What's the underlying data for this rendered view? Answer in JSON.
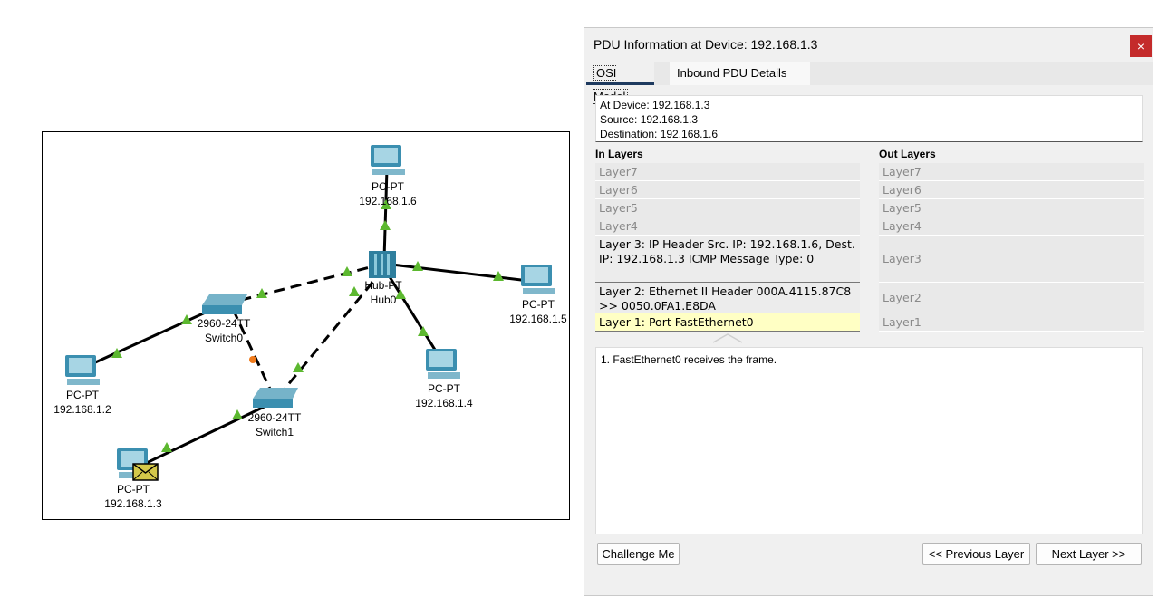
{
  "topology": {
    "devices": [
      {
        "id": "pc6",
        "type": "PC-PT",
        "ip": "192.168.1.6"
      },
      {
        "id": "hub0",
        "type": "Hub-PT",
        "name": "Hub0"
      },
      {
        "id": "pc5",
        "type": "PC-PT",
        "ip": "192.168.1.5"
      },
      {
        "id": "switch0",
        "type": "2960-24TT",
        "name": "Switch0"
      },
      {
        "id": "pc4",
        "type": "PC-PT",
        "ip": "192.168.1.4"
      },
      {
        "id": "pc2",
        "type": "PC-PT",
        "ip": "192.168.1.2"
      },
      {
        "id": "switch1",
        "type": "2960-24TT",
        "name": "Switch1"
      },
      {
        "id": "pc3",
        "type": "PC-PT",
        "ip": "192.168.1.3"
      }
    ],
    "colors": {
      "link": "#000000",
      "link_up": "#5cb82f",
      "link_pending": "#f07a1a",
      "device": "#3b8fb0",
      "envelope": "#d4c84a"
    }
  },
  "dialog": {
    "title": "PDU Information at Device: 192.168.1.3",
    "close_icon": "×",
    "tabs": [
      {
        "label": "OSI Model",
        "selected": true
      },
      {
        "label": "Inbound PDU Details",
        "selected": false
      }
    ],
    "info": {
      "at_device": "At Device: 192.168.1.3",
      "source": "Source: 192.168.1.3",
      "destination": "Destination: 192.168.1.6"
    },
    "in_layers_title": "In Layers",
    "out_layers_title": "Out Layers",
    "in_layers": [
      "Layer7",
      "Layer6",
      "Layer5",
      "Layer4",
      "Layer 3: IP Header Src. IP: 192.168.1.6, Dest. IP: 192.168.1.3 ICMP Message Type: 0",
      "Layer 2: Ethernet II Header 000A.4115.87C8 >> 0050.0FA1.E8DA",
      "Layer 1: Port FastEthernet0"
    ],
    "out_layers": [
      "Layer7",
      "Layer6",
      "Layer5",
      "Layer4",
      "Layer3",
      "Layer2",
      "Layer1"
    ],
    "description": "1. FastEthernet0 receives the frame.",
    "buttons": {
      "challenge": "Challenge Me",
      "previous": "<< Previous Layer",
      "next": "Next Layer >>"
    }
  }
}
